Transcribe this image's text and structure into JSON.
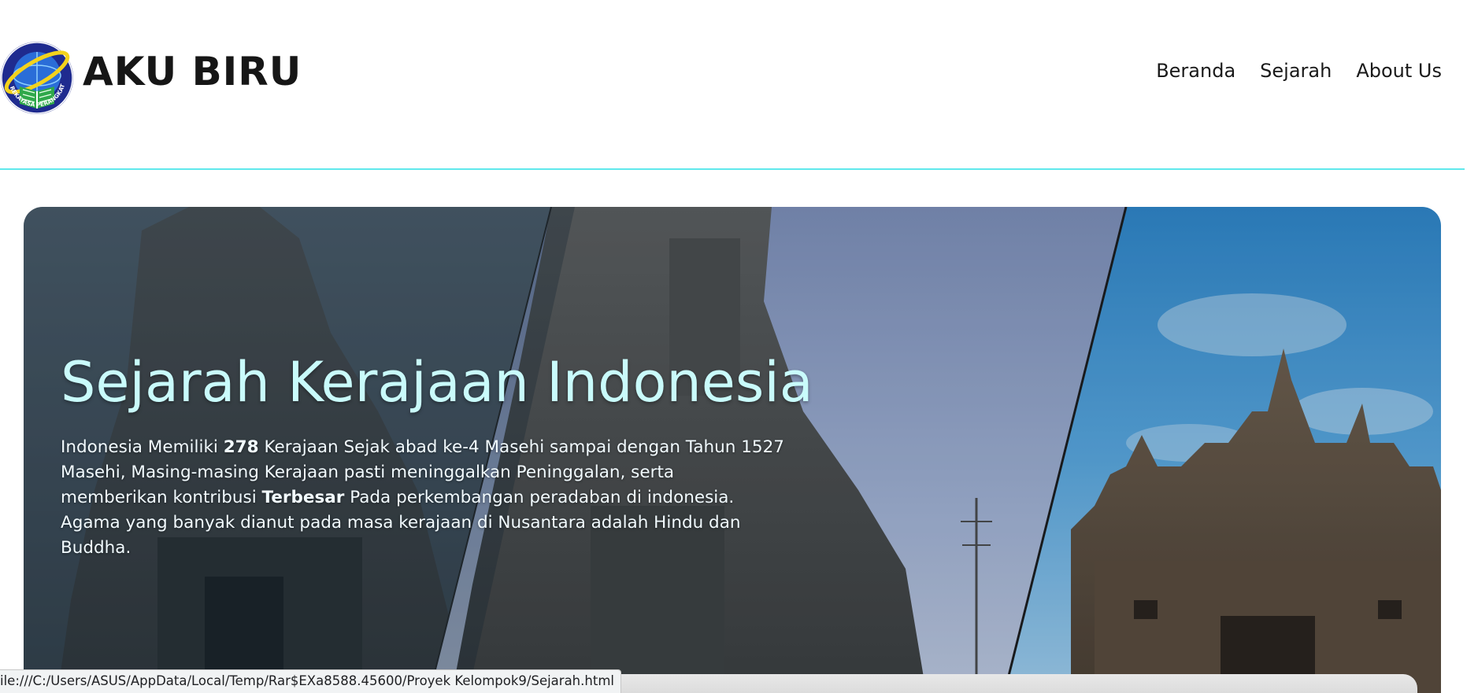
{
  "header": {
    "brand": "AKU BIRU",
    "logo_text": "REKAYASA PERANGKAT LUNAK",
    "nav": [
      {
        "label": "Beranda"
      },
      {
        "label": "Sejarah"
      },
      {
        "label": "About Us"
      }
    ]
  },
  "hero": {
    "title": "Sejarah Kerajaan Indonesia",
    "desc_part1": "Indonesia Memiliki ",
    "desc_bold1": "278",
    "desc_part2": " Kerajaan Sejak abad ke-4 Masehi sampai dengan Tahun 1527 Masehi, Masing-masing Kerajaan pasti meninggalkan Peninggalan, serta memberikan kontribusi ",
    "desc_bold2": "Terbesar",
    "desc_part3": " Pada perkembangan peradaban di indonesia. Agama yang banyak dianut pada masa kerajaan di Nusantara adalah Hindu dan Buddha."
  },
  "statusbar": {
    "url": "ile:///C:/Users/ASUS/AppData/Local/Temp/Rar$EXa8588.45600/Proyek Kelompok9/Sejarah.html"
  },
  "colors": {
    "accent_line": "#5fe8ec",
    "title": "#c9fbfb",
    "logo_blue": "#1f2b8f",
    "logo_yellow": "#f3d21c",
    "logo_green": "#2fa84a"
  }
}
